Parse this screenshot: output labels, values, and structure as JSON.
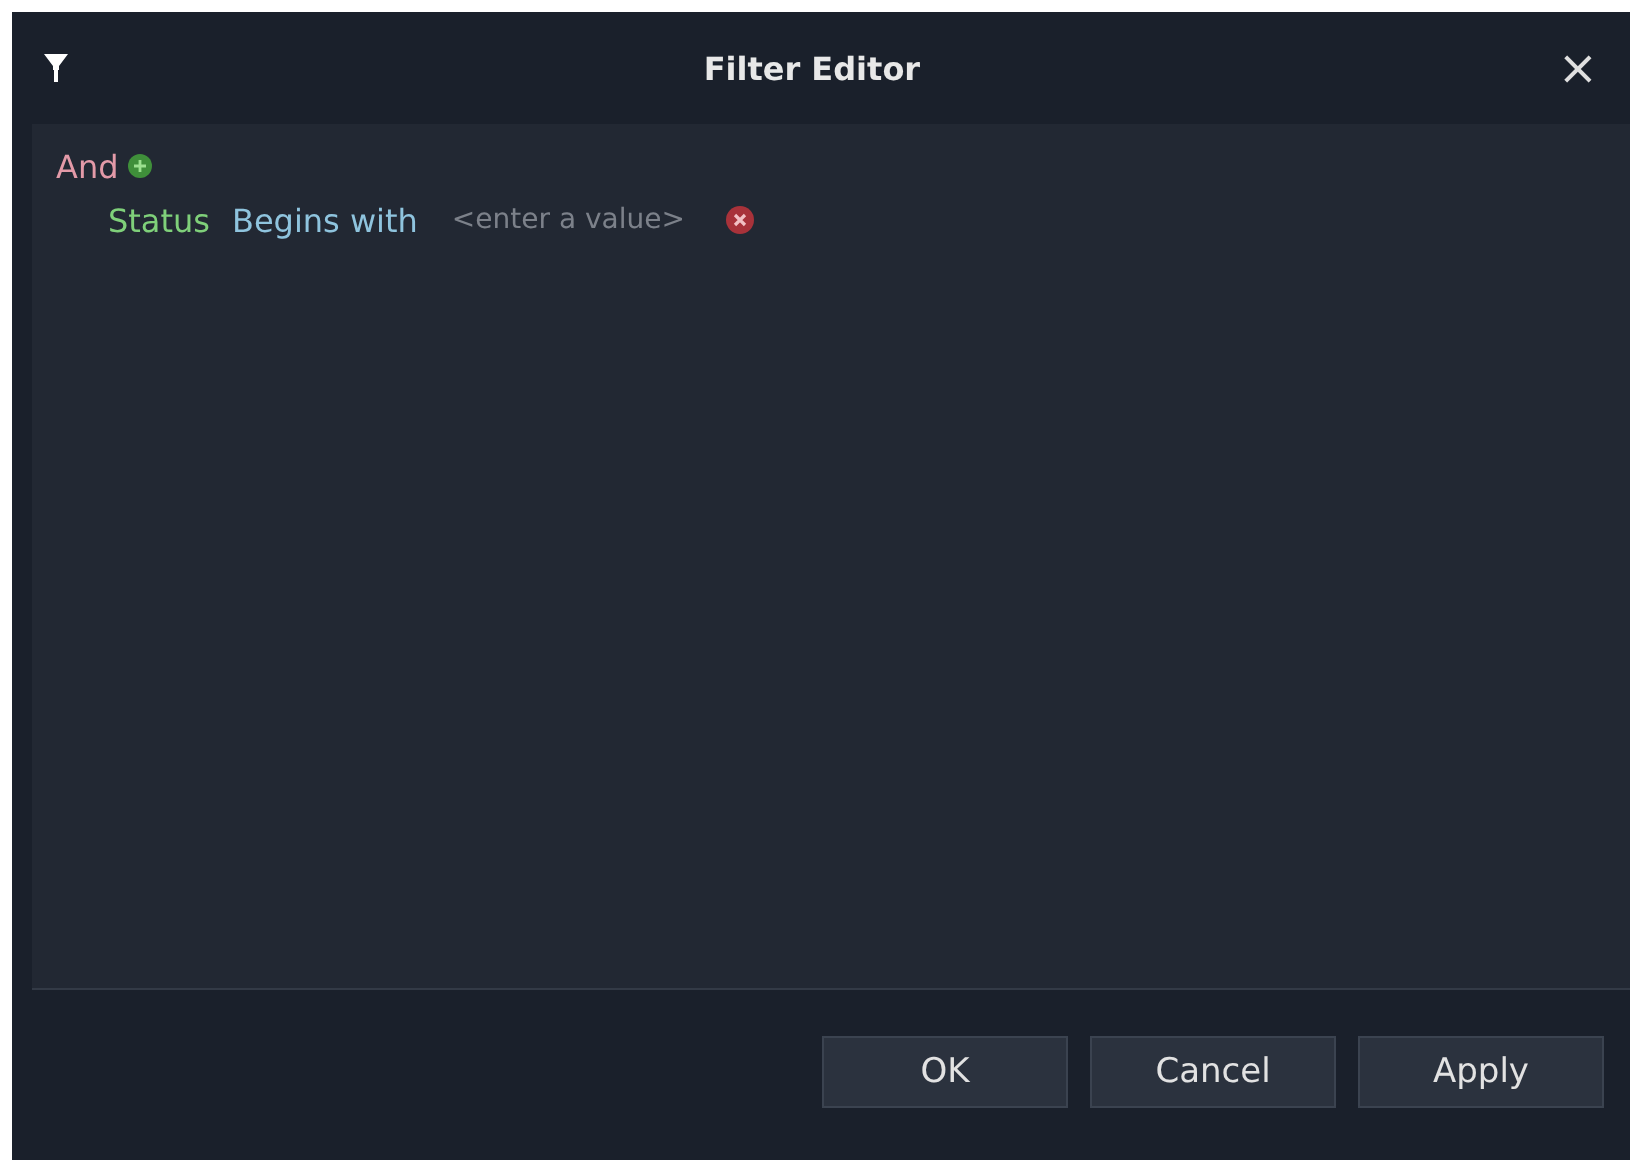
{
  "window": {
    "title": "Filter Editor",
    "close": "×"
  },
  "filter": {
    "group_operator": "And",
    "conditions": [
      {
        "field": "Status",
        "operator": "Begins with",
        "placeholder": "<enter a value>"
      }
    ]
  },
  "buttons": [
    "OK",
    "Cancel",
    "Apply"
  ]
}
